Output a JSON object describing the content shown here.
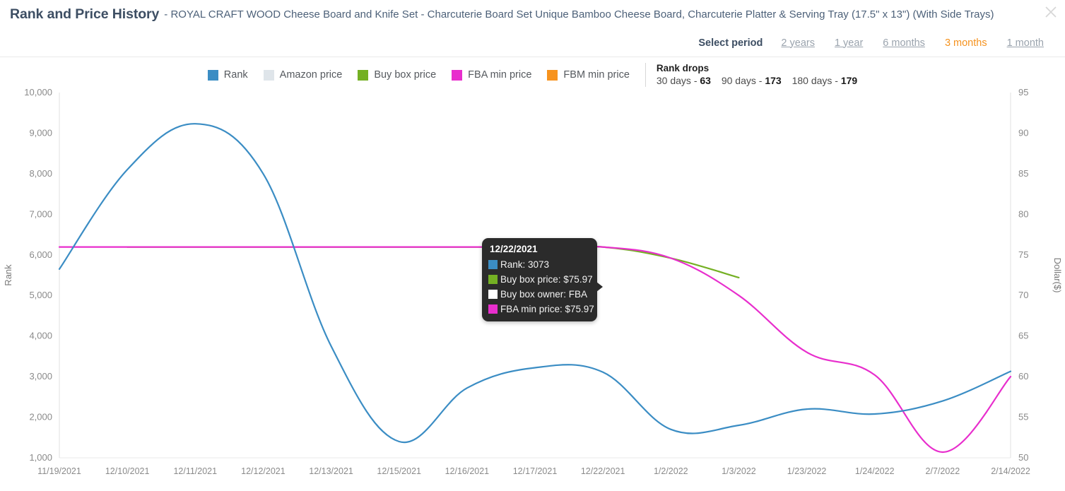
{
  "header": {
    "title": "Rank and Price History",
    "subtitle": "- ROYAL CRAFT WOOD Cheese Board and Knife Set - Charcuterie Board Set Unique Bamboo Cheese Board, Charcuterie Platter & Serving Tray (17.5\" x 13\") (With Side Trays)",
    "close_icon": "close-icon"
  },
  "period": {
    "label": "Select period",
    "options": [
      {
        "label": "2 years",
        "active": false
      },
      {
        "label": "1 year",
        "active": false
      },
      {
        "label": "6 months",
        "active": false
      },
      {
        "label": "3 months",
        "active": true
      },
      {
        "label": "1 month",
        "active": false
      }
    ],
    "active_color": "#f5921e",
    "inactive_color": "#9aa3ad"
  },
  "legend": {
    "items": [
      {
        "label": "Rank",
        "color": "#3b8dc4"
      },
      {
        "label": "Amazon price",
        "color": "#dfe5ea"
      },
      {
        "label": "Buy box price",
        "color": "#74b023"
      },
      {
        "label": "FBA min price",
        "color": "#e82ecd"
      },
      {
        "label": "FBM min price",
        "color": "#f7931e"
      }
    ]
  },
  "rank_drops": {
    "title": "Rank drops",
    "entries": [
      {
        "period": "30 days -",
        "value": "63"
      },
      {
        "period": "90 days -",
        "value": "173"
      },
      {
        "period": "180 days -",
        "value": "179"
      }
    ]
  },
  "tooltip": {
    "date": "12/22/2021",
    "rows": [
      {
        "label": "Rank: 3073",
        "color": "#3b8dc4"
      },
      {
        "label": "Buy box price: $75.97",
        "color": "#74b023"
      },
      {
        "label": "Buy box owner: FBA",
        "color": "#ffffff"
      },
      {
        "label": "FBA min price: $75.97",
        "color": "#e82ecd"
      }
    ]
  },
  "chart_data": {
    "type": "line",
    "title": "Rank and Price History",
    "xlabel": "",
    "ylabel": "Rank",
    "y2label": "Dollar($)",
    "grid": false,
    "legend_position": "top-center",
    "categories": [
      "11/19/2021",
      "12/10/2021",
      "12/11/2021",
      "12/12/2021",
      "12/13/2021",
      "12/15/2021",
      "12/16/2021",
      "12/17/2021",
      "12/22/2021",
      "1/2/2022",
      "1/3/2022",
      "1/23/2022",
      "1/24/2022",
      "2/7/2022",
      "2/14/2022"
    ],
    "ylim": [
      1000,
      10000
    ],
    "yticks": [
      1000,
      2000,
      3000,
      4000,
      5000,
      6000,
      7000,
      8000,
      9000,
      10000
    ],
    "ytick_labels": [
      "1,000",
      "2,000",
      "3,000",
      "4,000",
      "5,000",
      "6,000",
      "7,000",
      "8,000",
      "9,000",
      "10,000"
    ],
    "y2lim": [
      50,
      95
    ],
    "y2ticks": [
      50,
      55,
      60,
      65,
      70,
      75,
      80,
      85,
      90,
      95
    ],
    "y2tick_labels": [
      "50",
      "55",
      "60",
      "65",
      "70",
      "75",
      "80",
      "85",
      "90",
      "95"
    ],
    "series": [
      {
        "name": "Rank",
        "color": "#3b8dc4",
        "axis": "left",
        "values": [
          5650,
          8100,
          9230,
          8000,
          3750,
          1400,
          2720,
          3220,
          3110,
          1700,
          1800,
          2200,
          2080,
          2400,
          3130
        ]
      },
      {
        "name": "Buy box price",
        "color": "#74b023",
        "axis": "right",
        "values": [
          null,
          75.97,
          75.97,
          75.97,
          75.97,
          75.97,
          75.97,
          75.97,
          75.97,
          74.6,
          72.2,
          null,
          null,
          null,
          null
        ]
      },
      {
        "name": "FBA min price",
        "color": "#e82ecd",
        "axis": "right",
        "values": [
          75.97,
          75.97,
          75.97,
          75.97,
          75.97,
          75.97,
          75.97,
          75.97,
          75.97,
          74.6,
          70.0,
          63.0,
          60.2,
          50.7,
          60.0
        ]
      },
      {
        "name": "Amazon price",
        "color": "#dfe5ea",
        "axis": "right",
        "values": [
          null,
          null,
          null,
          null,
          null,
          null,
          null,
          null,
          null,
          null,
          null,
          null,
          null,
          null,
          null
        ]
      },
      {
        "name": "FBM min price",
        "color": "#f7931e",
        "axis": "right",
        "values": [
          null,
          null,
          null,
          null,
          null,
          null,
          null,
          null,
          null,
          null,
          null,
          null,
          null,
          null,
          null
        ]
      }
    ]
  }
}
